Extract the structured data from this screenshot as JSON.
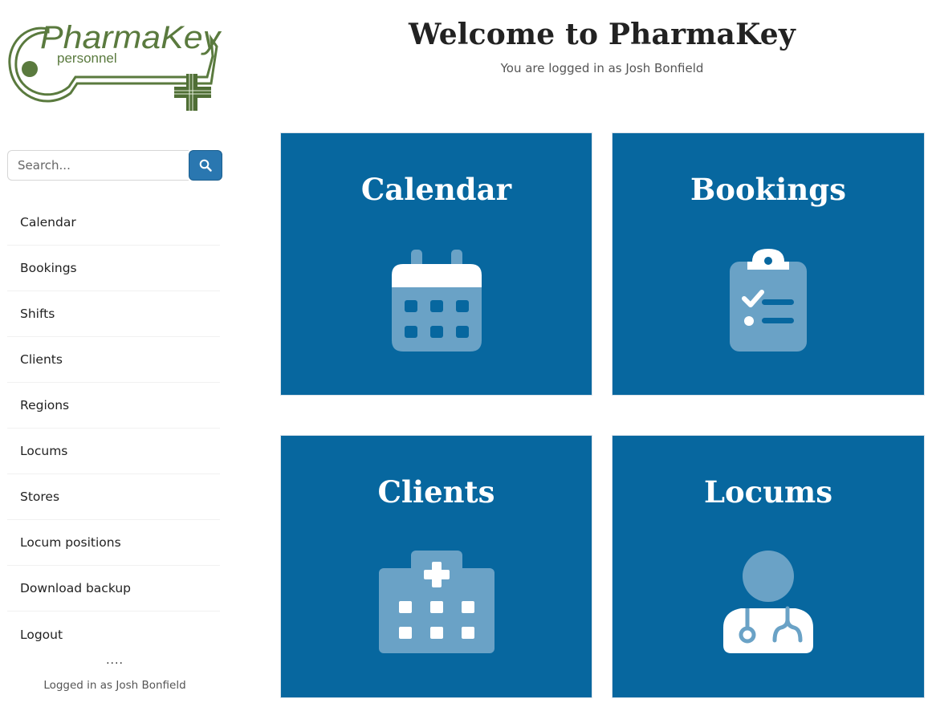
{
  "brand": {
    "logo_name": "PharmaKey",
    "logo_sub": "personnel"
  },
  "search": {
    "placeholder": "Search..."
  },
  "sidebar": {
    "items": [
      {
        "label": "Calendar"
      },
      {
        "label": "Bookings"
      },
      {
        "label": "Shifts"
      },
      {
        "label": "Clients"
      },
      {
        "label": "Regions"
      },
      {
        "label": "Locums"
      },
      {
        "label": "Stores"
      },
      {
        "label": "Locum positions"
      },
      {
        "label": "Download backup"
      },
      {
        "label": "Logout"
      }
    ],
    "dots": "....",
    "logged_in": "Logged in as Josh Bonfield"
  },
  "header": {
    "title": "Welcome to PharmaKey",
    "subtitle": "You are logged in as Josh Bonfield"
  },
  "cards": [
    {
      "label": "Calendar",
      "icon": "calendar-icon"
    },
    {
      "label": "Bookings",
      "icon": "clipboard-check-icon"
    },
    {
      "label": "Clients",
      "icon": "hospital-icon"
    },
    {
      "label": "Locums",
      "icon": "doctor-icon"
    }
  ],
  "colors": {
    "card_bg": "#07679f",
    "icon_fill": "#6aa2c6",
    "logo_green": "#5a7a3e",
    "search_button": "#2a77b0"
  }
}
